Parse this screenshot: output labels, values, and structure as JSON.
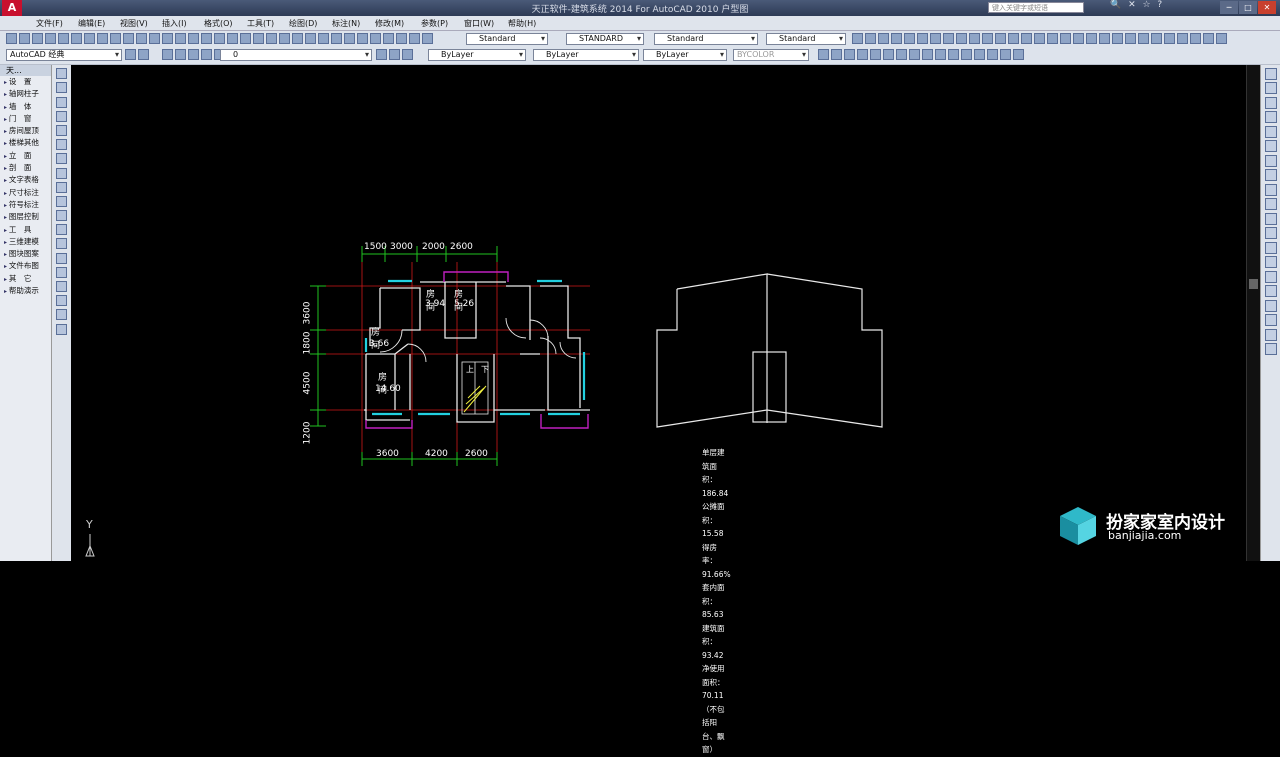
{
  "titlebar": {
    "app_logo": "A",
    "title": "天正软件-建筑系统 2014  For AutoCAD 2010    户型图",
    "search_placeholder": "键入关键字或短语"
  },
  "menu": {
    "items": [
      "文件(F)",
      "编辑(E)",
      "视图(V)",
      "插入(I)",
      "格式(O)",
      "工具(T)",
      "绘图(D)",
      "标注(N)",
      "修改(M)",
      "参数(P)",
      "窗口(W)",
      "帮助(H)"
    ]
  },
  "toolbar": {
    "text_style": "Standard",
    "dim_style": "STANDARD",
    "table_style": "Standard",
    "mleader_style": "Standard",
    "workspace": "AutoCAD 经典",
    "layer": "0",
    "color": "ByLayer",
    "linetype": "ByLayer",
    "lineweight": "ByLayer",
    "plotstyle": "BYCOLOR"
  },
  "sidebar": {
    "header": "天...",
    "items": [
      "设　置",
      "轴网柱子",
      "墙　体",
      "门　窗",
      "房间屋顶",
      "楼梯其他",
      "立　面",
      "剖　面",
      "文字表格",
      "尺寸标注",
      "符号标注",
      "图层控制",
      "工　具",
      "三维建模",
      "图块图案",
      "文件布图",
      "其　它",
      "帮助演示"
    ]
  },
  "drawing": {
    "dims_top": [
      "1500",
      "3000",
      "2000",
      "2600"
    ],
    "dims_bottom": [
      "3600",
      "4200",
      "2600"
    ],
    "dims_left": [
      "3600",
      "1800",
      "4500",
      "1200"
    ],
    "rooms": [
      {
        "name": "房间",
        "area": "3.94"
      },
      {
        "name": "房间",
        "area": "5.26"
      },
      {
        "name": "房间",
        "area": "3.66"
      },
      {
        "name": "房间",
        "area": "14.60"
      }
    ],
    "stair_labels": [
      "上",
      "下"
    ],
    "stats": [
      "单层建筑面积：186.84",
      "公摊面积：15.58",
      "得房率：91.66%",
      "套内面积：85.63",
      "建筑面积：93.42",
      "净使用面积：70.11（不包括阳台、飘窗）"
    ],
    "ucs_label": "Y"
  },
  "watermark": {
    "text": "扮家家室内设计",
    "sub": "banjiajia.com"
  }
}
